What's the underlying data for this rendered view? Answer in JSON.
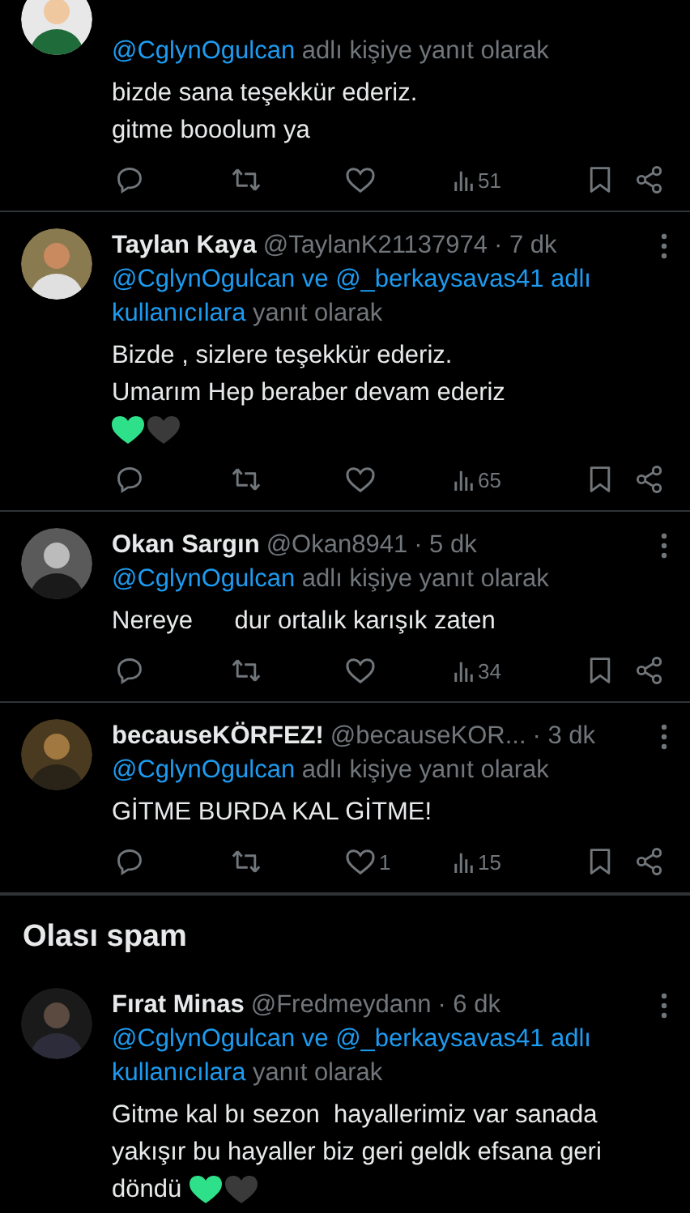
{
  "sections": [
    {
      "tweets": [
        {
          "reply_to": [
            {
              "text": "@CglynOgulcan",
              "kind": "link"
            },
            {
              "text": "adlı kişiye yanıt olarak",
              "kind": "plain"
            }
          ],
          "lines": [
            {
              "text": "bizde sana teşekkür ederiz."
            },
            {
              "text": "gitme booolum ya"
            }
          ],
          "views": "51"
        },
        {
          "name": "Taylan Kaya",
          "handle": "@TaylanK21137974",
          "time": "· 7 dk",
          "reply_to": [
            {
              "text": "@CglynOgulcan ve @_berkaysavas41 adlı",
              "kind": "link"
            },
            {
              "text": "kullanıcılara",
              "kind": "link"
            },
            {
              "text": "yanıt olarak",
              "kind": "plain"
            }
          ],
          "lines": [
            {
              "text": "Bizde , sizlere teşekkür ederiz."
            },
            {
              "text": "Umarım Hep beraber devam ederiz"
            },
            {
              "hearts": [
                {
                  "color": "#2fe08a"
                },
                {
                  "color": "#3a3a3a"
                }
              ]
            }
          ],
          "views": "65"
        },
        {
          "name": "Okan Sargın",
          "handle": "@Okan8941",
          "time": "· 5 dk",
          "reply_to": [
            {
              "text": "@CglynOgulcan",
              "kind": "link"
            },
            {
              "text": "adlı kişiye yanıt olarak",
              "kind": "plain"
            }
          ],
          "lines": [
            {
              "text": "Nereye      dur ortalık karışık zaten"
            }
          ],
          "views": "34"
        },
        {
          "name": "becauseKÖRFEZ!",
          "handle": "@becauseKOR...",
          "time": "· 3 dk",
          "reply_to": [
            {
              "text": "@CglynOgulcan",
              "kind": "link"
            },
            {
              "text": "adlı kişiye yanıt olarak",
              "kind": "plain"
            }
          ],
          "lines": [
            {
              "text": "GİTME BURDA KAL GİTME!"
            }
          ],
          "likes": "1",
          "views": "15"
        }
      ]
    },
    {
      "heading": "Olası spam",
      "tweets": [
        {
          "name": "Fırat Minas",
          "handle": "@Fredmeydann",
          "time": "· 6 dk",
          "reply_to": [
            {
              "text": "@CglynOgulcan ve @_berkaysavas41 adlı",
              "kind": "link"
            },
            {
              "text": "kullanıcılara",
              "kind": "link"
            },
            {
              "text": "yanıt olarak",
              "kind": "plain"
            }
          ],
          "lines": [
            {
              "text": "Gitme kal bı sezon  hayallerimiz var sanada"
            },
            {
              "text": "yakışır bu hayaller biz geri geldk efsana geri"
            },
            {
              "text": "döndü",
              "hearts": [
                {
                  "color": "#2fe08a"
                },
                {
                  "color": "#3a3a3a"
                }
              ]
            }
          ]
        }
      ]
    }
  ]
}
